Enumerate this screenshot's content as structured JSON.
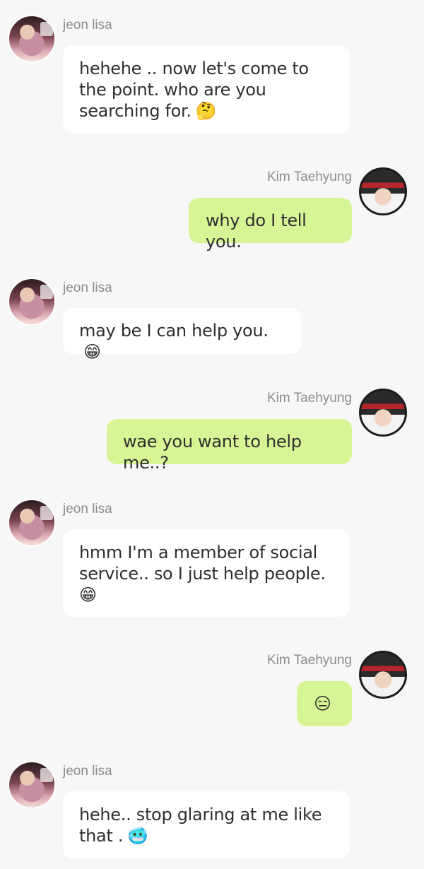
{
  "messages": [
    {
      "sender": "jeon lisa",
      "side": "left",
      "avatar": "lisa-avatar",
      "text": "hehehe .. now let's come to the point.  who are you searching for.",
      "emoji": "🤔"
    },
    {
      "sender": "Kim Taehyung",
      "side": "right",
      "avatar": "taehyung-avatar",
      "text": "why do I tell you.",
      "emoji": ""
    },
    {
      "sender": "jeon lisa",
      "side": "left",
      "avatar": "lisa-avatar",
      "text": "may be I can help you.",
      "emoji": "😁"
    },
    {
      "sender": "Kim Taehyung",
      "side": "right",
      "avatar": "taehyung-avatar",
      "text": "wae you want to help me..?",
      "emoji": ""
    },
    {
      "sender": "jeon lisa",
      "side": "left",
      "avatar": "lisa-avatar",
      "text": "hmm I'm a member of social service.. so I just help people.",
      "emoji": "😁"
    },
    {
      "sender": "Kim Taehyung",
      "side": "right",
      "avatar": "taehyung-avatar",
      "text": "",
      "emoji": "😑"
    },
    {
      "sender": "jeon lisa",
      "side": "left",
      "avatar": "lisa-avatar",
      "text": "hehe.. stop glaring at me like that .",
      "emoji": "🥶"
    }
  ],
  "colors": {
    "background": "#f7f7f7",
    "incoming_bubble": "#ffffff",
    "outgoing_bubble": "#d8f595",
    "sender_name": "#8d8d8d",
    "message_text": "#2f2f2f"
  }
}
